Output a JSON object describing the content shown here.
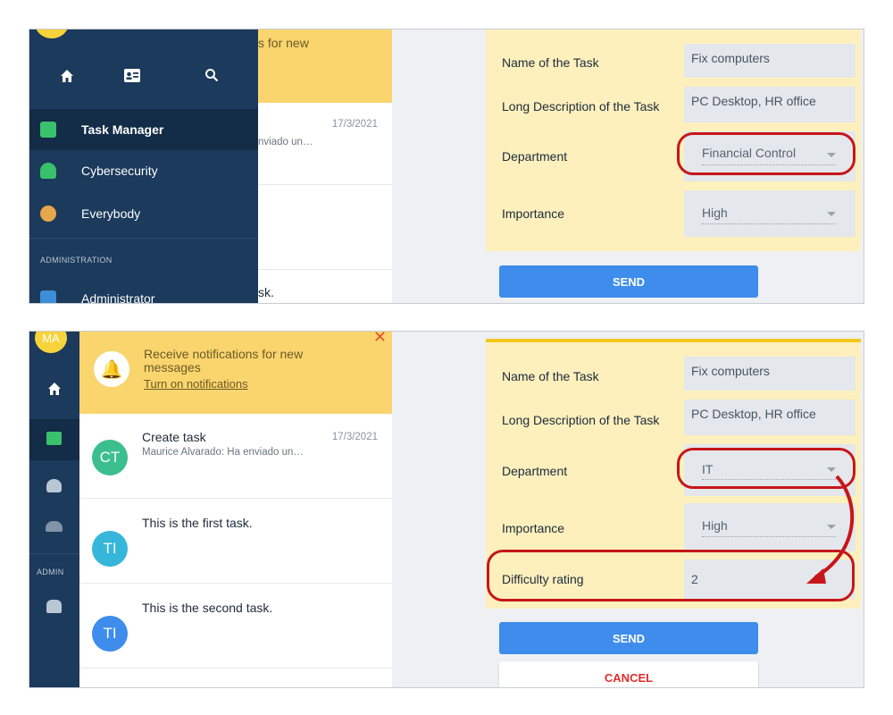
{
  "panel1": {
    "notification_partial": "s for new",
    "sidebar": {
      "items": [
        {
          "label": "Task Manager",
          "icon": "briefcase-icon",
          "active": true,
          "color": "#39c16c"
        },
        {
          "label": "Cybersecurity",
          "icon": "robot-icon",
          "active": false,
          "color": "#39c16c"
        },
        {
          "label": "Everybody",
          "icon": "group-icon",
          "active": false,
          "color": "#e8a64a"
        }
      ],
      "section": "ADMINISTRATION",
      "admin_item": "Administrator"
    },
    "chat": {
      "date": "17/3/2021",
      "sub_partial": "nviado un…",
      "task_partial": "sk."
    },
    "form": {
      "name_label": "Name of the Task",
      "name_value": "Fix computers",
      "desc_label": "Long Description of the Task",
      "desc_value": "PC Desktop, HR office",
      "dept_label": "Department",
      "dept_value": "Financial Control",
      "importance_label": "Importance",
      "importance_value": "High",
      "send": "SEND"
    }
  },
  "panel2": {
    "avatar_text": "MA",
    "admin_section": "ADMIN",
    "notification": {
      "text": "Receive notifications for new messages",
      "link": "Turn on notifications"
    },
    "chats": [
      {
        "initials": "CT",
        "color": "#3bbf8e",
        "title": "Create task",
        "sub": "Maurice Alvarado: Ha enviado un…",
        "date": "17/3/2021"
      },
      {
        "initials": "TI",
        "color": "#35b6da",
        "title": "This is the first task.",
        "sub": "",
        "date": ""
      },
      {
        "initials": "TI",
        "color": "#3e8ceb",
        "title": "This is the second task.",
        "sub": "",
        "date": ""
      }
    ],
    "form": {
      "name_label": "Name of the Task",
      "name_value": "Fix computers",
      "desc_label": "Long Description of the Task",
      "desc_value": "PC Desktop, HR office",
      "dept_label": "Department",
      "dept_value": "IT",
      "importance_label": "Importance",
      "importance_value": "High",
      "difficulty_label": "Difficulty rating",
      "difficulty_value": "2",
      "send": "SEND",
      "cancel": "CANCEL"
    }
  },
  "colors": {
    "sidebar": "#1b3a5c",
    "notification": "#fad56e",
    "form_card": "#fdf0bd",
    "primary_button": "#3e8ceb",
    "highlight": "#c6161a"
  }
}
